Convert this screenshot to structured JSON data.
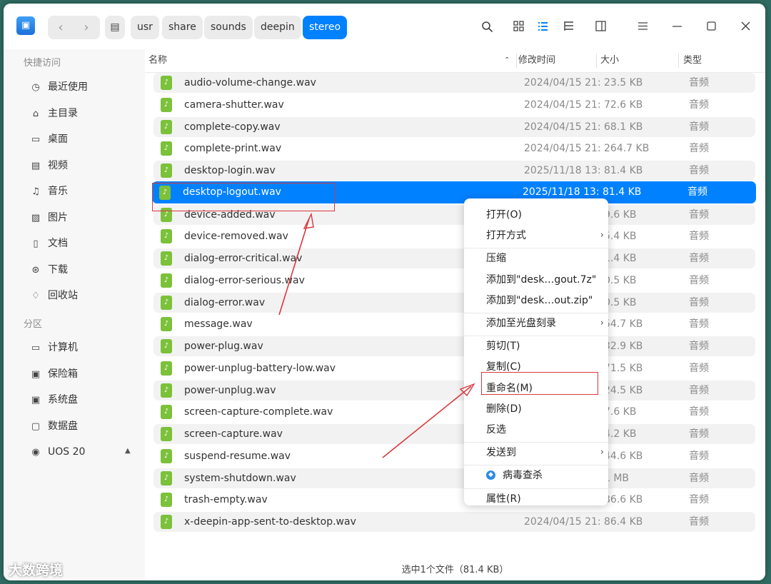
{
  "window": {
    "back_glyph": "‹",
    "forward_glyph": "›",
    "breadcrumb": [
      "usr",
      "share",
      "sounds",
      "deepin",
      "stereo"
    ],
    "toolbar_icons": [
      "search-icon",
      "icon-view-icon",
      "list-view-icon",
      "tree-view-icon",
      "detail-panel-icon",
      "menu-icon",
      "minimize-icon",
      "maximize-icon",
      "close-icon"
    ]
  },
  "sidebar": {
    "quick_access_label": "快捷访问",
    "quick_access": [
      {
        "label": "最近使用",
        "icon": "clock-icon"
      },
      {
        "label": "主目录",
        "icon": "home-icon"
      },
      {
        "label": "桌面",
        "icon": "desktop-icon"
      },
      {
        "label": "视频",
        "icon": "video-icon"
      },
      {
        "label": "音乐",
        "icon": "music-icon"
      },
      {
        "label": "图片",
        "icon": "picture-icon"
      },
      {
        "label": "文档",
        "icon": "document-icon"
      },
      {
        "label": "下载",
        "icon": "download-icon"
      },
      {
        "label": "回收站",
        "icon": "trash-icon"
      }
    ],
    "partition_label": "分区",
    "partitions": [
      {
        "label": "计算机",
        "icon": "computer-icon"
      },
      {
        "label": "保险箱",
        "icon": "vault-icon"
      },
      {
        "label": "系统盘",
        "icon": "system-disk-icon"
      },
      {
        "label": "数据盘",
        "icon": "data-disk-icon"
      },
      {
        "label": "UOS 20",
        "icon": "optical-disc-icon"
      }
    ]
  },
  "columns": {
    "name": "名称",
    "modified": "修改时间",
    "size": "大小",
    "type": "类型"
  },
  "files": [
    {
      "name": "audio-volume-change.wav",
      "modified": "2024/04/15 21:…",
      "size": "23.5 KB",
      "type": "音频"
    },
    {
      "name": "camera-shutter.wav",
      "modified": "2024/04/15 21:…",
      "size": "72.6 KB",
      "type": "音频"
    },
    {
      "name": "complete-copy.wav",
      "modified": "2024/04/15 21:…",
      "size": "68.1 KB",
      "type": "音频"
    },
    {
      "name": "complete-print.wav",
      "modified": "2024/04/15 21:…",
      "size": "264.7 KB",
      "type": "音频"
    },
    {
      "name": "desktop-login.wav",
      "modified": "2025/11/18 13:…",
      "size": "81.4 KB",
      "type": "音频"
    },
    {
      "name": "desktop-logout.wav",
      "modified": "2025/11/18 13:…",
      "size": "81.4 KB",
      "type": "音频",
      "selected": true
    },
    {
      "name": "device-added.wav",
      "modified": "",
      "size": "9.6 KB",
      "type": "音频"
    },
    {
      "name": "device-removed.wav",
      "modified": "",
      "size": "5.4 KB",
      "type": "音频"
    },
    {
      "name": "dialog-error-critical.wav",
      "modified": "",
      "size": "1.4 KB",
      "type": "音频"
    },
    {
      "name": "dialog-error-serious.wav",
      "modified": "",
      "size": "0.5 KB",
      "type": "音频"
    },
    {
      "name": "dialog-error.wav",
      "modified": "",
      "size": "0.5 KB",
      "type": "音频"
    },
    {
      "name": "message.wav",
      "modified": "",
      "size": "54.7 KB",
      "type": "音频"
    },
    {
      "name": "power-plug.wav",
      "modified": "",
      "size": "32.9 KB",
      "type": "音频"
    },
    {
      "name": "power-unplug-battery-low.wav",
      "modified": "",
      "size": "71.5 KB",
      "type": "音频"
    },
    {
      "name": "power-unplug.wav",
      "modified": "",
      "size": "24.5 KB",
      "type": "音频"
    },
    {
      "name": "screen-capture-complete.wav",
      "modified": "",
      "size": "7.6 KB",
      "type": "音频"
    },
    {
      "name": "screen-capture.wav",
      "modified": "",
      "size": "4.2 KB",
      "type": "音频"
    },
    {
      "name": "suspend-resume.wav",
      "modified": "",
      "size": "44.6 KB",
      "type": "音频"
    },
    {
      "name": "system-shutdown.wav",
      "modified": "",
      "size": "1 MB",
      "type": "音频"
    },
    {
      "name": "trash-empty.wav",
      "modified": "",
      "size": "86.6 KB",
      "type": "音频"
    },
    {
      "name": "x-deepin-app-sent-to-desktop.wav",
      "modified": "2024/04/15 21:…",
      "size": "86.4 KB",
      "type": "音频"
    }
  ],
  "context_menu": [
    {
      "label": "打开(O)"
    },
    {
      "label": "打开方式",
      "submenu": true
    },
    {
      "separator": true
    },
    {
      "label": "压缩"
    },
    {
      "label": "添加到\"desk…gout.7z\""
    },
    {
      "label": "添加到\"desk…out.zip\""
    },
    {
      "separator": true
    },
    {
      "label": "添加至光盘刻录",
      "submenu": true
    },
    {
      "separator": true
    },
    {
      "label": "剪切(T)"
    },
    {
      "label": "复制(C)"
    },
    {
      "label": "重命名(M)",
      "highlighted": true
    },
    {
      "label": "删除(D)"
    },
    {
      "label": "反选"
    },
    {
      "separator": true
    },
    {
      "label": "发送到",
      "submenu": true
    },
    {
      "separator": true
    },
    {
      "label": "病毒查杀",
      "icon": "shield-scan-icon"
    },
    {
      "separator": true
    },
    {
      "label": "属性(R)"
    }
  ],
  "status_bar": "选中1个文件（81.4 KB）",
  "watermark": "大数跨境",
  "colors": {
    "accent": "#0081ff",
    "annotation": "#d9383e",
    "file_icon": "#7bc13a"
  }
}
